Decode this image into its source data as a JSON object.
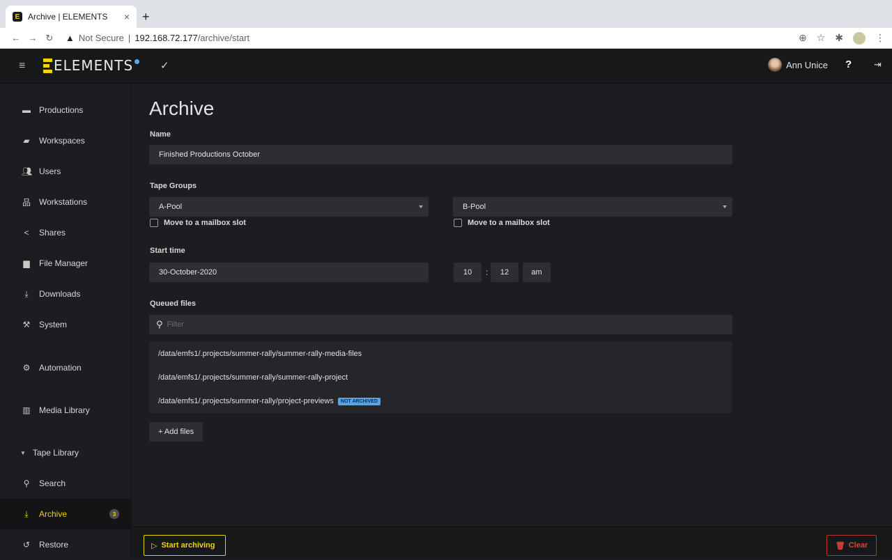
{
  "browser": {
    "tab_title": "Archive | ELEMENTS",
    "tab_close": "×",
    "new_tab": "+",
    "security": "Not Secure",
    "separator": "|",
    "url_host": "192.168.72.177",
    "url_path": "/archive/start"
  },
  "header": {
    "logo_text": "ELEMENTS",
    "user_name": "Ann Unice",
    "help": "?"
  },
  "sidebar": {
    "items": [
      {
        "label": "Productions",
        "icon": "briefcase-icon"
      },
      {
        "label": "Workspaces",
        "icon": "folder-icon"
      },
      {
        "label": "Users",
        "icon": "users-icon"
      },
      {
        "label": "Workstations",
        "icon": "network-icon"
      },
      {
        "label": "Shares",
        "icon": "share-icon"
      },
      {
        "label": "File Manager",
        "icon": "folders-icon"
      },
      {
        "label": "Downloads",
        "icon": "download-icon"
      },
      {
        "label": "System",
        "icon": "wrench-icon"
      },
      {
        "label": "Automation",
        "icon": "gears-icon"
      },
      {
        "label": "Media Library",
        "icon": "film-icon"
      }
    ],
    "tape_library": "Tape Library",
    "search": "Search",
    "archive": "Archive",
    "archive_badge": "3",
    "restore": "Restore"
  },
  "main": {
    "title": "Archive",
    "name_label": "Name",
    "name_value": "Finished Productions October",
    "tape_groups_label": "Tape Groups",
    "pool_a": "A-Pool",
    "pool_b": "B-Pool",
    "mailbox_a": "Move to a mailbox slot",
    "mailbox_b": "Move to a mailbox slot",
    "start_time_label": "Start time",
    "date_value": "30-October-2020",
    "hour": "10",
    "colon": ":",
    "minute": "12",
    "ampm": "am",
    "queued_label": "Queued files",
    "filter_placeholder": "Filter",
    "files": [
      {
        "path": "/data/emfs1/.projects/summer-rally/summer-rally-media-files"
      },
      {
        "path": "/data/emfs1/.projects/summer-rally/summer-rally-project"
      },
      {
        "path": "/data/emfs1/.projects/summer-rally/project-previews",
        "tag": "NOT ARCHIVED"
      }
    ],
    "add_files": "+ Add files"
  },
  "footer": {
    "start": "Start archiving",
    "clear": "Clear"
  },
  "colors": {
    "accent": "#f2d300",
    "danger": "#e0403a",
    "tag": "#5aa3e3"
  }
}
